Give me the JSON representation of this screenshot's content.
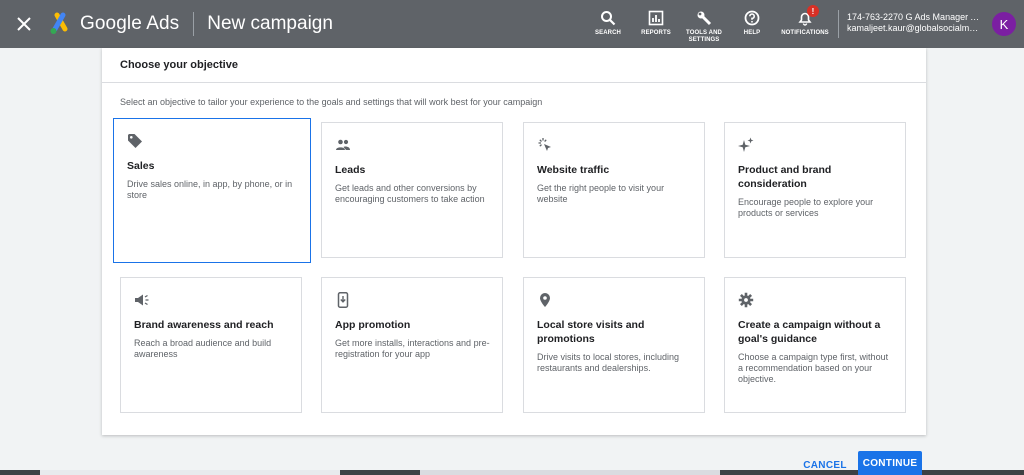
{
  "topbar": {
    "brand": "Google Ads",
    "title": "New campaign",
    "tools": [
      {
        "label": "SEARCH",
        "icon": "search-icon"
      },
      {
        "label": "REPORTS",
        "icon": "reports-icon"
      },
      {
        "label": "TOOLS AND SETTINGS",
        "icon": "wrench-icon"
      },
      {
        "label": "HELP",
        "icon": "help-icon"
      },
      {
        "label": "NOTIFICATIONS",
        "icon": "bell-icon",
        "badge": "!"
      }
    ],
    "account_line1": "174-763-2270 G Ads Manager A...",
    "account_line2": "kamaljeet.kaur@globalsocialme...",
    "avatar_letter": "K"
  },
  "panel": {
    "header": "Choose your objective",
    "subtitle": "Select an objective to tailor your experience to the goals and settings that will work best for your campaign",
    "cards": [
      {
        "title": "Sales",
        "desc": "Drive sales online, in app, by phone, or in store",
        "icon": "tag-icon",
        "selected": true
      },
      {
        "title": "Leads",
        "desc": "Get leads and other conversions by encouraging customers to take action",
        "icon": "people-icon"
      },
      {
        "title": "Website traffic",
        "desc": "Get the right people to visit your website",
        "icon": "cursor-click-icon"
      },
      {
        "title": "Product and brand consideration",
        "desc": "Encourage people to explore your products or services",
        "icon": "sparkle-icon"
      },
      {
        "title": "Brand awareness and reach",
        "desc": "Reach a broad audience and build awareness",
        "icon": "megaphone-icon"
      },
      {
        "title": "App promotion",
        "desc": "Get more installs, interactions and pre-registration for your app",
        "icon": "phone-download-icon"
      },
      {
        "title": "Local store visits and promotions",
        "desc": "Drive visits to local stores, including restaurants and dealerships.",
        "icon": "location-pin-icon"
      },
      {
        "title": "Create a campaign without a goal's guidance",
        "desc": "Choose a campaign type first, without a recommendation based on your objective.",
        "icon": "gear-icon"
      }
    ]
  },
  "actions": {
    "cancel": "CANCEL",
    "continue": "CONTINUE"
  },
  "colors": {
    "topbar": "#5f6368",
    "accent": "#1a73e8",
    "avatar": "#7b1fa2",
    "badge": "#d93025"
  }
}
